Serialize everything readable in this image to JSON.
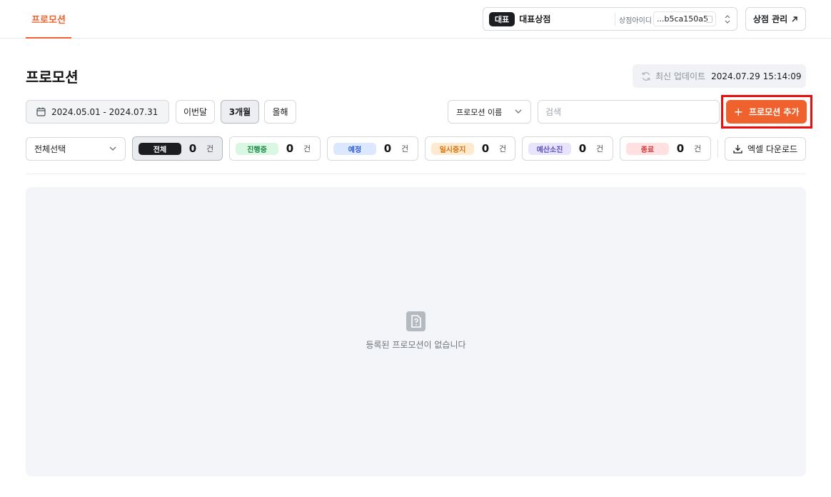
{
  "header": {
    "tab_label": "프로모션",
    "store": {
      "badge": "대표",
      "name": "대표상점",
      "id_label": "상점아이디",
      "id_value": "...b5ca150a5"
    },
    "manage_label": "상점 관리",
    "manage_icon": "external-arrow-icon"
  },
  "page": {
    "title": "프로모션",
    "update_label": "최신 업데이트",
    "update_value": "2024.07.29 15:14:09"
  },
  "filters": {
    "date_range": "2024.05.01 - 2024.07.31",
    "periods": [
      {
        "label": "이번달",
        "active": false
      },
      {
        "label": "3개월",
        "active": true
      },
      {
        "label": "올해",
        "active": false
      }
    ],
    "search_type": "프로모션 이름",
    "search_placeholder": "검색",
    "add_label": "프로모션 추가"
  },
  "status": {
    "select_label": "전체선택",
    "unit": "건",
    "chips": [
      {
        "label": "전체",
        "count": "0",
        "bg": "#1b1d21",
        "fg": "#ffffff",
        "active": true
      },
      {
        "label": "진행중",
        "count": "0",
        "bg": "#d9f7e2",
        "fg": "#1a8a45",
        "active": false
      },
      {
        "label": "예정",
        "count": "0",
        "bg": "#dce8ff",
        "fg": "#2b5bd7",
        "active": false
      },
      {
        "label": "일시중지",
        "count": "0",
        "bg": "#ffe9cf",
        "fg": "#d4730e",
        "active": false
      },
      {
        "label": "예산소진",
        "count": "0",
        "bg": "#e7e4fb",
        "fg": "#5b4fc4",
        "active": false
      },
      {
        "label": "종료",
        "count": "0",
        "bg": "#ffe1e1",
        "fg": "#d43a3a",
        "active": false
      }
    ],
    "excel_label": "엑셀 다운로드"
  },
  "empty": {
    "message": "등록된 프로모션이 없습니다"
  },
  "colors": {
    "accent": "#f0622d",
    "highlight": "#ee0d0d"
  }
}
